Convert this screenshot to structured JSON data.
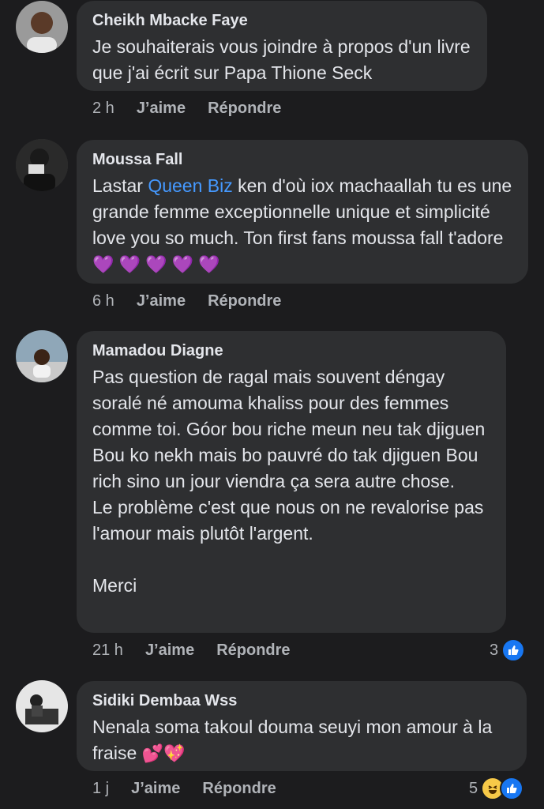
{
  "comments": [
    {
      "author": "Cheikh Mbacke Faye",
      "text": "Je souhaiterais vous joindre à propos d'un livre que j'ai écrit sur Papa Thione Seck",
      "time": "2 h",
      "like_label": "J’aime",
      "reply_label": "Répondre"
    },
    {
      "author": "Moussa Fall",
      "text_before": "Lastar ",
      "mention": "Queen Biz",
      "text_after": " ken d'où iox machaallah tu es une grande femme exceptionnelle unique et simplicité love you so much. Ton first fans moussa fall t'adore ",
      "emojis": "💜 💜 💜 💜 💜",
      "time": "6 h",
      "like_label": "J’aime",
      "reply_label": "Répondre"
    },
    {
      "author": "Mamadou Diagne",
      "text": "Pas question de ragal mais souvent déngay soralé né amouma khaliss pour des femmes comme toi. Góor bou riche meun neu tak djiguen Bou ko nekh mais bo pauvré do tak djiguen Bou rich sino un jour viendra ça sera autre chose.\nLe problème c'est que nous on ne revalorise pas l'amour mais plutôt l'argent.\n\nMerci",
      "time": "21 h",
      "like_label": "J’aime",
      "reply_label": "Répondre",
      "reaction_count": "3",
      "reaction_icons": [
        "like-icon"
      ]
    },
    {
      "author": "Sidiki Dembaa Wss",
      "text": "Nenala soma takoul douma seuyi mon amour à la fraise ",
      "emojis": "💕💖",
      "time": "1 j",
      "like_label": "J’aime",
      "reply_label": "Répondre",
      "reaction_count": "5",
      "reaction_icons": [
        "haha-icon",
        "like-icon"
      ]
    }
  ],
  "colors": {
    "background": "#1c1c1e",
    "bubble": "#2e2f31",
    "mention": "#4599ff",
    "meta": "#b0b3b8",
    "like": "#1877f2"
  }
}
